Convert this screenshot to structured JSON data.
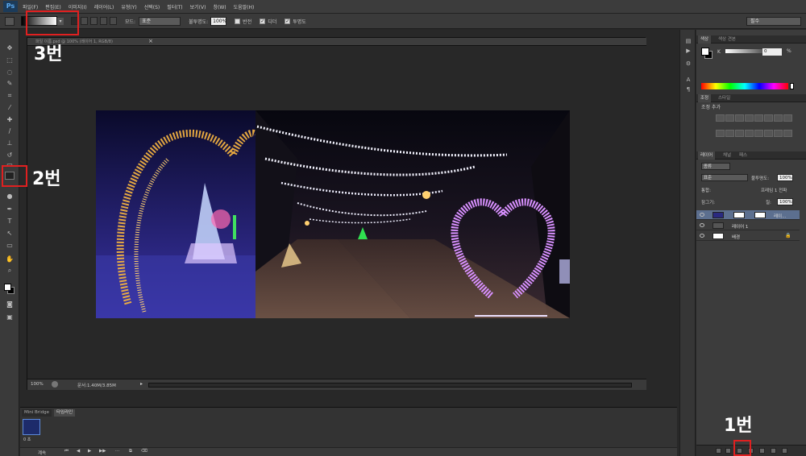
{
  "app": {
    "logo": "Ps"
  },
  "menu": [
    "파일(F)",
    "편집(E)",
    "이미지(I)",
    "레이어(L)",
    "유형(Y)",
    "선택(S)",
    "필터(T)",
    "보기(V)",
    "창(W)",
    "도움말(H)"
  ],
  "options": {
    "mode_label": "모드:",
    "mode_value": "표준",
    "opacity_label": "불투명도:",
    "opacity_value": "100%",
    "reverse_label": "반전",
    "dither_label": "디더",
    "transparency_label": "투명도",
    "workspace_value": "필수"
  },
  "document": {
    "tab_title": "파일 이름.psd @ 100% (레이어 1, RGB/8)",
    "zoom": "100%",
    "doc_info": "문서:1.40M/3.85M"
  },
  "bottom_panel": {
    "tab_bridge": "Mini Bridge",
    "tab_timeline": "타임라인",
    "frame_time": "0 초",
    "loop": "계속"
  },
  "panels": {
    "color_tabs": [
      "색상",
      "색상 견본"
    ],
    "color_k_label": "K",
    "color_k_value": "0",
    "color_k_unit": "%",
    "adjust_tabs": [
      "조정",
      "스타일"
    ],
    "adjust_title": "조정 추가",
    "layer_tabs": [
      "레이어",
      "채널",
      "패스"
    ],
    "kind_filter": "종류",
    "blend_mode": "표준",
    "opacity_label": "불투명도:",
    "opacity_value": "100%",
    "unify_label": "통합:",
    "propagate_label": "프레임 1 전파",
    "lock_label": "잠그기:",
    "fill_label": "칠:",
    "fill_value": "100%",
    "layers": [
      {
        "name": "레이...",
        "selected": true
      },
      {
        "name": "레이어 1",
        "selected": false
      },
      {
        "name": "배경",
        "selected": false
      }
    ]
  },
  "annotations": {
    "label_1": "1번",
    "label_2": "2번",
    "label_3": "3번",
    "color": "#e02020"
  }
}
